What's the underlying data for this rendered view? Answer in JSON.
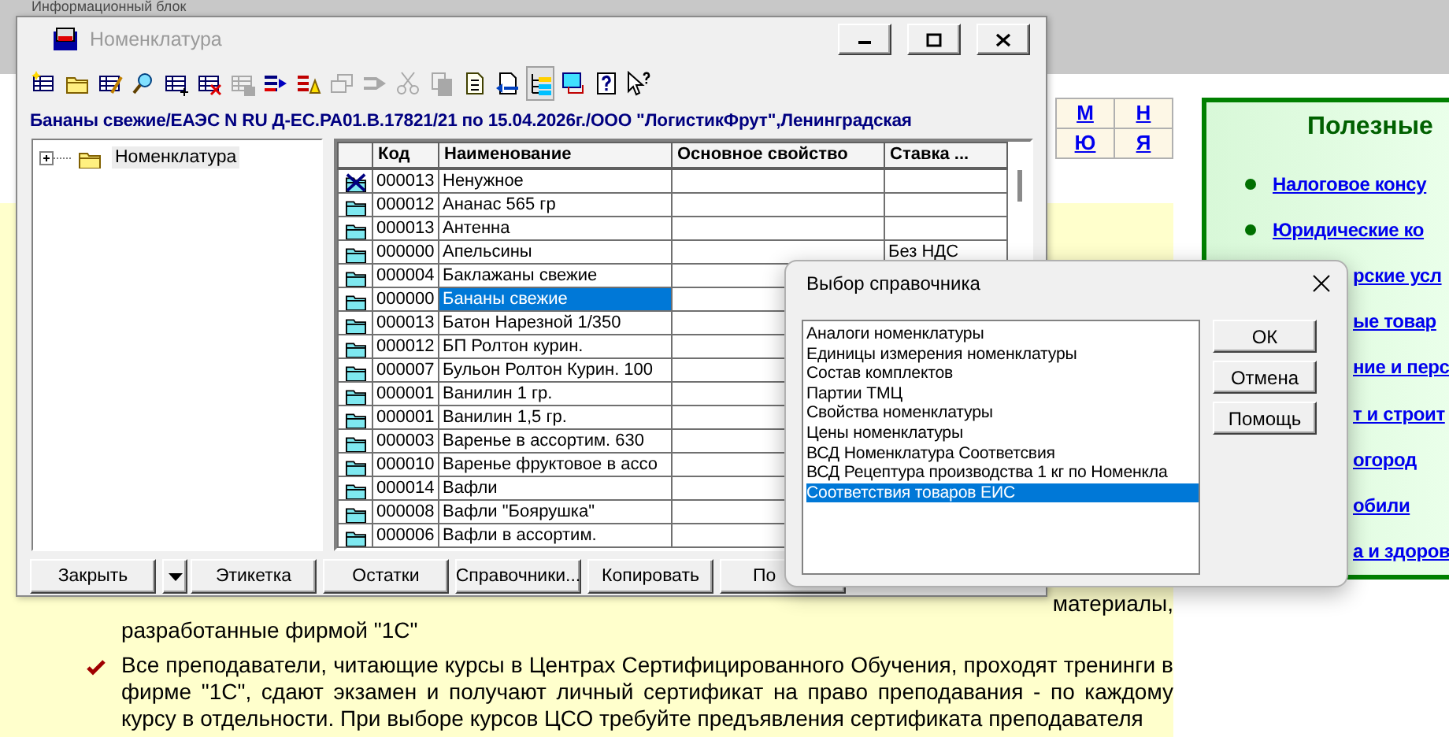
{
  "background_page": {
    "header": "Информационный блок",
    "letter_index": [
      [
        "М",
        "Н"
      ],
      [
        "Ю",
        "Я"
      ]
    ],
    "useful_panel": {
      "title": "Полезные",
      "links": [
        {
          "text": "Налоговое консу",
          "covered": false
        },
        {
          "text": "Юридические ко",
          "covered": false
        },
        {
          "text": "рские усл",
          "covered": true
        },
        {
          "text": "ые товар",
          "covered": true
        },
        {
          "text": "ние и перс",
          "covered": true
        },
        {
          "text": "т и строит",
          "covered": true
        },
        {
          "text": "огород",
          "covered": true
        },
        {
          "text": "обили",
          "covered": true
        },
        {
          "text": "а и здоров",
          "covered": true
        }
      ]
    },
    "text_block": {
      "line_end": "материалы,",
      "line": "разработанные фирмой \"1С\"",
      "bullet": "Все преподаватели, читающие курсы в Центрах Сертифицированного Обучения, проходят тренинги в фирме \"1С\", сдают экзамен и получают личный сертификат на право преподавания - по каждому курсу в отдельности. При выборе курсов ЦСО требуйте предъявления сертификата преподавателя"
    }
  },
  "main_window": {
    "title": "Номенклатура",
    "toolbar": [
      {
        "kind": "new-item",
        "disabled": false,
        "pressed": false
      },
      {
        "kind": "new-folder",
        "disabled": false,
        "pressed": false
      },
      {
        "kind": "edit",
        "disabled": false,
        "pressed": false
      },
      {
        "kind": "search",
        "disabled": false,
        "pressed": false
      },
      {
        "kind": "add-row",
        "disabled": false,
        "pressed": false
      },
      {
        "kind": "delete-row",
        "disabled": false,
        "pressed": false
      },
      {
        "kind": "copy-row",
        "disabled": true,
        "pressed": false
      },
      {
        "kind": "move",
        "disabled": false,
        "pressed": false
      },
      {
        "kind": "move-group",
        "disabled": false,
        "pressed": false
      },
      {
        "kind": "duplicate",
        "disabled": true,
        "pressed": false
      },
      {
        "kind": "transfer",
        "disabled": true,
        "pressed": false
      },
      {
        "kind": "link",
        "disabled": true,
        "pressed": false
      },
      {
        "kind": "copy",
        "disabled": true,
        "pressed": false
      },
      {
        "kind": "document",
        "disabled": false,
        "pressed": false
      },
      {
        "kind": "report",
        "disabled": false,
        "pressed": false
      },
      {
        "kind": "tree",
        "disabled": false,
        "pressed": true
      },
      {
        "kind": "table",
        "disabled": false,
        "pressed": false
      },
      {
        "kind": "help",
        "disabled": false,
        "pressed": false
      },
      {
        "kind": "whatsthis",
        "disabled": false,
        "pressed": false
      }
    ],
    "info_line": "Бананы  свежие/ЕАЭС N RU Д-ЕС.РА01.В.17821/21 по 15.04.2026г./ООО \"ЛогистикФрут\",Ленинградская",
    "tree": [
      {
        "label": "Номенклатура",
        "expanded": false,
        "selected": true
      }
    ],
    "table": {
      "columns": [
        "Код",
        "Наименование",
        "Основное свойство",
        "Ставка ..."
      ],
      "rows": [
        {
          "code": "000013",
          "name": "Ненужное",
          "property": "",
          "rate": "",
          "deleted": true,
          "selected": false
        },
        {
          "code": "000012",
          "name": "Ананас 565 гр",
          "property": "",
          "rate": "",
          "deleted": false,
          "selected": false
        },
        {
          "code": "000013",
          "name": "Антенна",
          "property": "",
          "rate": "",
          "deleted": false,
          "selected": false
        },
        {
          "code": "000000",
          "name": "Апельсины",
          "property": "",
          "rate": "Без НДС",
          "deleted": false,
          "selected": false
        },
        {
          "code": "000004",
          "name": "Баклажаны свежие",
          "property": "",
          "rate": "",
          "deleted": false,
          "selected": false
        },
        {
          "code": "000000",
          "name": "Бананы свежие",
          "property": "",
          "rate": "",
          "deleted": false,
          "selected": true
        },
        {
          "code": "000013",
          "name": "Батон Нарезной  1/350",
          "property": "",
          "rate": "",
          "deleted": false,
          "selected": false
        },
        {
          "code": "000012",
          "name": "БП  Ролтон курин.",
          "property": "",
          "rate": "",
          "deleted": false,
          "selected": false
        },
        {
          "code": "000007",
          "name": "Бульон Ролтон Курин. 100",
          "property": "",
          "rate": "",
          "deleted": false,
          "selected": false
        },
        {
          "code": "000001",
          "name": "Ванилин   1 гр.",
          "property": "",
          "rate": "",
          "deleted": false,
          "selected": false
        },
        {
          "code": "000001",
          "name": "Ванилин  1,5 гр.",
          "property": "",
          "rate": "",
          "deleted": false,
          "selected": false
        },
        {
          "code": "000003",
          "name": "Варенье в ассортим.  630",
          "property": "",
          "rate": "",
          "deleted": false,
          "selected": false
        },
        {
          "code": "000010",
          "name": "Варенье фруктовое в ассо",
          "property": "",
          "rate": "",
          "deleted": false,
          "selected": false
        },
        {
          "code": "000014",
          "name": "Вафли",
          "property": "",
          "rate": "",
          "deleted": false,
          "selected": false
        },
        {
          "code": "000008",
          "name": "Вафли \"Боярушка\"",
          "property": "",
          "rate": "",
          "deleted": false,
          "selected": false
        },
        {
          "code": "000006",
          "name": "Вафли в ассортим.",
          "property": "",
          "rate": "",
          "deleted": false,
          "selected": false
        }
      ]
    },
    "buttons": [
      {
        "kind": "button",
        "label": "Закрыть"
      },
      {
        "kind": "dropdown"
      },
      {
        "kind": "button",
        "label": "Этикетка"
      },
      {
        "kind": "button",
        "label": "Остатки"
      },
      {
        "kind": "button",
        "label": "Справочники..."
      },
      {
        "kind": "button",
        "label": "Копировать"
      },
      {
        "kind": "button",
        "label": "По"
      }
    ]
  },
  "dialog": {
    "title": "Выбор справочника",
    "items": [
      {
        "label": "Аналоги номенклатуры",
        "selected": false
      },
      {
        "label": "Единицы измерения номенклатуры",
        "selected": false
      },
      {
        "label": "Состав комплектов",
        "selected": false
      },
      {
        "label": "Партии ТМЦ",
        "selected": false
      },
      {
        "label": "Свойства номенклатуры",
        "selected": false
      },
      {
        "label": "Цены номенклатуры",
        "selected": false
      },
      {
        "label": "ВСД Номенклатура Соответсвия",
        "selected": false
      },
      {
        "label": "ВСД Рецептура производства 1 кг по Номенкла",
        "selected": false
      },
      {
        "label": "Соответствия товаров ЕИС",
        "selected": true
      }
    ],
    "buttons": [
      "ОК",
      "Отмена",
      "Помощь"
    ]
  }
}
